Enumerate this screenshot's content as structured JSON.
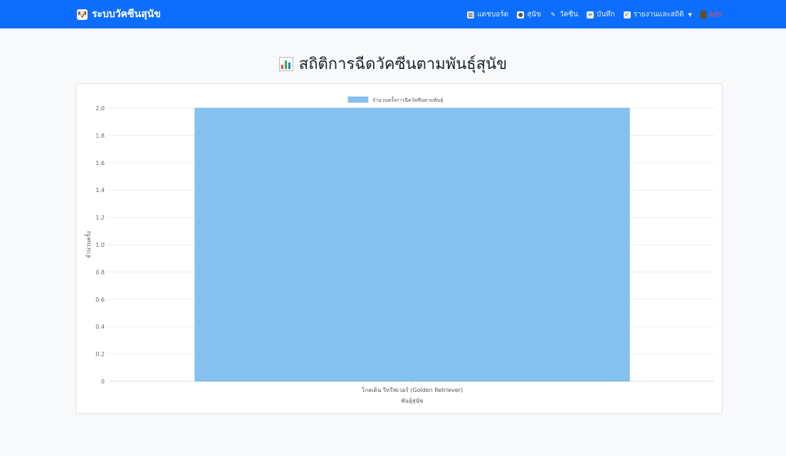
{
  "navbar": {
    "brand": "ระบบวัคซีนสุนัข",
    "brand_icon": "dog-face-icon",
    "items": [
      {
        "label": "แดชบอร์ด",
        "icon": "dashboard-icon"
      },
      {
        "label": "สุนัข",
        "icon": "dog-icon"
      },
      {
        "label": "วัคซีน",
        "icon": "pen-icon"
      },
      {
        "label": "บันทึก",
        "icon": "notebook-icon"
      },
      {
        "label": "รายงานและสถิติ",
        "icon": "report-icon"
      },
      {
        "label": "ออก",
        "icon": "logout-icon"
      }
    ],
    "logout_color": "#ff4d4d"
  },
  "page": {
    "title": "สถิติการฉีดวัคซีนตามพันธุ์สุนัข",
    "title_icon": "bar-chart-icon"
  },
  "chart_data": {
    "type": "bar",
    "categories": [
      "โกลเด้น รีทรีฟเวอร์ (Golden Retriever)"
    ],
    "series": [
      {
        "name": "จำนวนครั้งการฉีดวัคซีนตามพันธุ์",
        "values": [
          2
        ]
      }
    ],
    "xlabel": "พันธุ์สุนัข",
    "ylabel": "จำนวนครั้ง",
    "ylim": [
      0,
      2
    ],
    "yticks": [
      "0",
      "0.2",
      "0.4",
      "0.6",
      "0.8",
      "1.0",
      "1.2",
      "1.4",
      "1.6",
      "1.8",
      "2.0"
    ],
    "grid": true,
    "legend": "top-center",
    "bar_color": "#85c1ef",
    "bar_border": "#5dade2"
  }
}
